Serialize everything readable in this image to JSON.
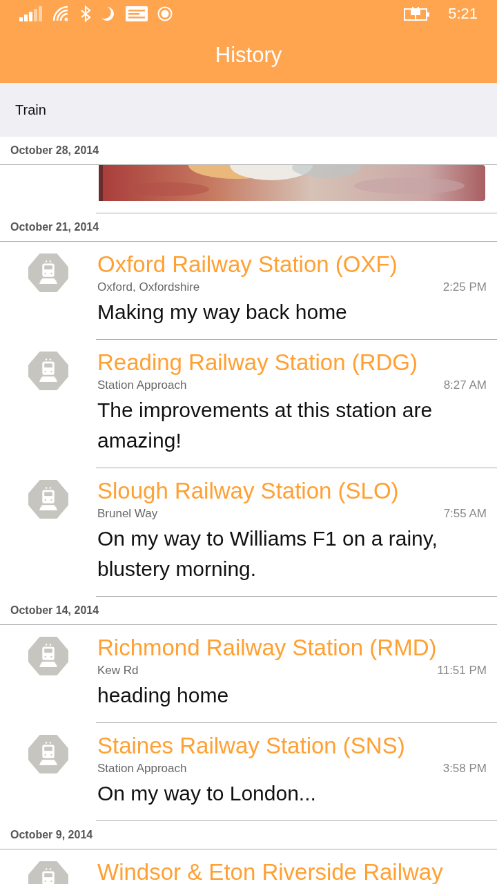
{
  "status_bar": {
    "time": "5:21"
  },
  "header": {
    "title": "History"
  },
  "filter": {
    "label": "Train"
  },
  "groups": [
    {
      "date": "October 28, 2014"
    },
    {
      "date": "October 21, 2014",
      "items": [
        {
          "kind": "checkin",
          "title": "Oxford Railway Station (OXF)",
          "place": "Oxford, Oxfordshire",
          "time": "2:25 PM",
          "text": "Making my way back home"
        },
        {
          "kind": "checkin",
          "title": "Reading Railway Station (RDG)",
          "place": "Station Approach",
          "time": "8:27 AM",
          "text": "The improvements at this station are amazing!"
        },
        {
          "kind": "checkin",
          "title": "Slough Railway Station (SLO)",
          "place": "Brunel Way",
          "time": "7:55 AM",
          "text": "On my way to Williams F1 on a rainy, blustery morning."
        }
      ]
    },
    {
      "date": "October 14, 2014",
      "items": [
        {
          "kind": "checkin",
          "title": "Richmond Railway Station (RMD)",
          "place": "Kew Rd",
          "time": "11:51 PM",
          "text": "heading home"
        },
        {
          "kind": "checkin",
          "title": "Staines Railway Station (SNS)",
          "place": "Station Approach",
          "time": "3:58 PM",
          "text": "On my way to London..."
        }
      ]
    },
    {
      "date": "October 9, 2014",
      "items": [
        {
          "kind": "checkin",
          "title": "Windsor & Eton Riverside Railway"
        }
      ]
    }
  ]
}
